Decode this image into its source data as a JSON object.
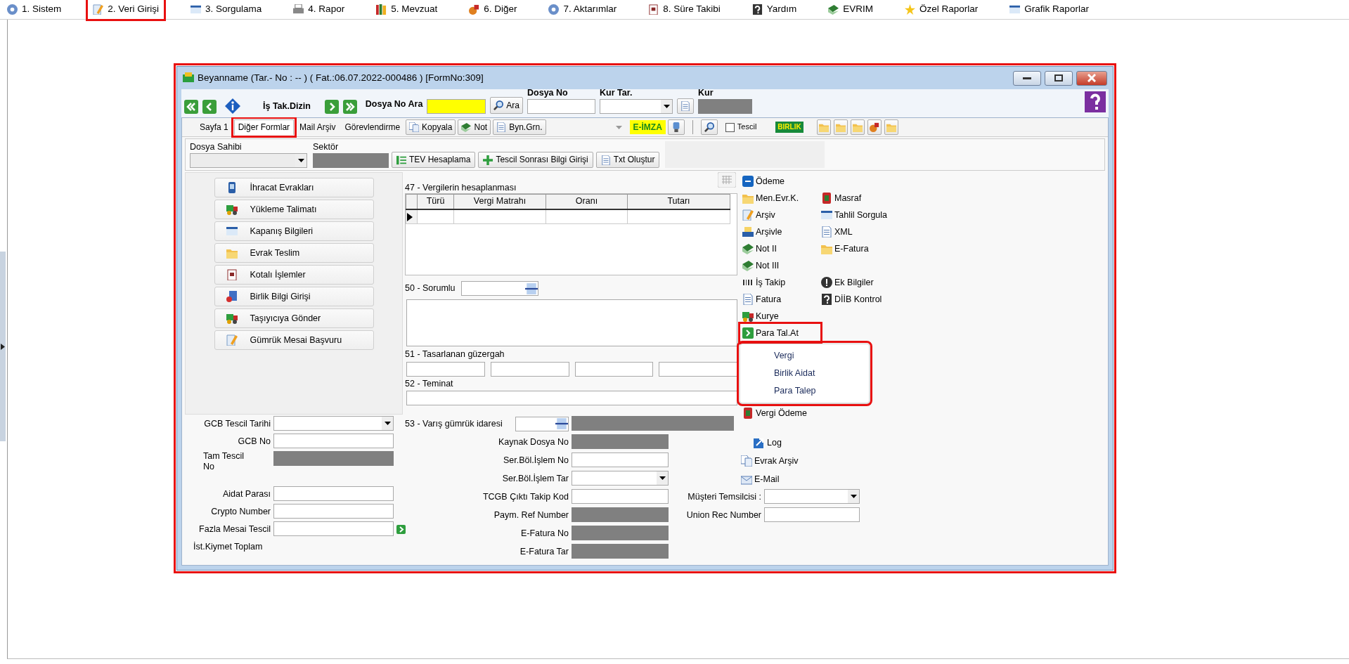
{
  "menu_bar": [
    {
      "label": "1. Sistem",
      "highlighted": false
    },
    {
      "label": "2. Veri Girişi",
      "highlighted": true
    },
    {
      "label": "3. Sorgulama",
      "highlighted": false
    },
    {
      "label": "4. Rapor",
      "highlighted": false
    },
    {
      "label": "5. Mevzuat",
      "highlighted": false
    },
    {
      "label": "6. Diğer",
      "highlighted": false
    },
    {
      "label": "7. Aktarımlar",
      "highlighted": false
    },
    {
      "label": "8. Süre Takibi",
      "highlighted": false
    },
    {
      "label": "Yardım",
      "highlighted": false
    },
    {
      "label": "EVRIM",
      "highlighted": false
    },
    {
      "label": "Özel Raporlar",
      "highlighted": false
    },
    {
      "label": "Grafik Raporlar",
      "highlighted": false
    }
  ],
  "window": {
    "title": "Beyanname (Tar.- No : -- ) ( Fat.:06.07.2022-000486 ) [FormNo:309]",
    "highlighted": true
  },
  "toolbar": {
    "dizin_label": "İş Tak.Dizin",
    "search_label": "Dosya No Ara",
    "search_button": "Ara",
    "dosya_no_label": "Dosya No",
    "kur_tar_label": "Kur Tar.",
    "kur_label": "Kur"
  },
  "tabs": [
    {
      "label": "Sayfa 1",
      "selected": false,
      "highlighted": false
    },
    {
      "label": "Diğer Formlar",
      "selected": true,
      "highlighted": true
    },
    {
      "label": "Mail Arşiv",
      "selected": false,
      "highlighted": false
    },
    {
      "label": "Görevlendirme",
      "selected": false,
      "highlighted": false
    }
  ],
  "tab_buttons": [
    "Kopyala",
    "Not",
    "Byn.Grn."
  ],
  "e_imza": "E-İMZA",
  "tescil_checkbox": {
    "label": "Tescil",
    "checked": false
  },
  "birlik_badge": "BIRLIK",
  "header": {
    "dosya_sahibi_label": "Dosya Sahibi",
    "sektor_label": "Sektör",
    "buttons": [
      "TEV Hesaplama",
      "Tescil Sonrası Bilgi Girişi",
      "Txt Oluştur"
    ]
  },
  "form_buttons": [
    "İhracat Evrakları",
    "Yükleme Talimatı",
    "Kapanış Bilgileri",
    "Evrak Teslim",
    "Kotalı İşlemler",
    "Birlik Bilgi Girişi",
    "Taşıyıcıya Gönder",
    "Gümrük Mesai Başvuru"
  ],
  "left_fields": [
    {
      "label": "GCB Tescil Tarihi",
      "kind": "select"
    },
    {
      "label": "GCB No",
      "kind": "input"
    },
    {
      "label": "Tam Tescil No",
      "kind": "readonly"
    },
    {
      "label": "Aidat Parası",
      "kind": "input"
    },
    {
      "label": "Crypto Number",
      "kind": "input"
    },
    {
      "label": "Fazla Mesai Tescil",
      "kind": "action"
    },
    {
      "label": "İst.Kiymet Toplam",
      "kind": "label"
    }
  ],
  "tax_table": {
    "title": "47 - Vergilerin hesaplanması",
    "columns": [
      "Türü",
      "Vergi Matrahı",
      "Oranı",
      "Tutarı"
    ]
  },
  "sorumlu_label": "50 - Sorumlu",
  "guzergah_label": "51 - Tasarlanan güzergah",
  "teminat_label": "52 - Teminat",
  "varis_label": "53 - Varış gümrük idaresi",
  "lower_fields": [
    {
      "label": "Kaynak Dosya No",
      "kind": "readonly"
    },
    {
      "label": "Ser.Böl.İşlem No",
      "kind": "input"
    },
    {
      "label": "Ser.Böl.İşlem Tar",
      "kind": "select"
    },
    {
      "label": "TCGB Çıktı Takip Kod",
      "kind": "input"
    },
    {
      "label": "Paym. Ref Number",
      "kind": "readonly"
    },
    {
      "label": "E-Fatura No",
      "kind": "readonly"
    },
    {
      "label": "E-Fatura Tar",
      "kind": "readonly"
    }
  ],
  "side_fields": [
    {
      "label": "Müşteri Temsilcisi :",
      "kind": "select"
    },
    {
      "label": "Union Rec Number",
      "kind": "input"
    }
  ],
  "action_rows": [
    [
      {
        "label": "Ödeme",
        "highlighted": false
      }
    ],
    [
      {
        "label": "Men.Evr.K.",
        "highlighted": false
      },
      {
        "label": "Masraf",
        "highlighted": false
      }
    ],
    [
      {
        "label": "Arşiv",
        "highlighted": false
      },
      {
        "label": "Tahlil Sorgula",
        "highlighted": false
      }
    ],
    [
      {
        "label": "Arşivle",
        "highlighted": false
      },
      {
        "label": "XML",
        "highlighted": false
      }
    ],
    [
      {
        "label": "Not II",
        "highlighted": false
      },
      {
        "label": "E-Fatura",
        "highlighted": false
      }
    ],
    [
      {
        "label": "Not III",
        "highlighted": false
      }
    ],
    [
      {
        "label": "İş Takip",
        "highlighted": false
      },
      {
        "label": "Ek Bilgiler",
        "highlighted": false
      }
    ],
    [
      {
        "label": "Fatura",
        "highlighted": false
      },
      {
        "label": "DİİB Kontrol",
        "highlighted": false
      }
    ],
    [
      {
        "label": "Kurye",
        "highlighted": false
      }
    ],
    [
      {
        "label": "Para Tal.At",
        "highlighted": true
      }
    ]
  ],
  "popup_menu": {
    "highlighted": true,
    "items": [
      "Vergi",
      "Birlik Aidat",
      "Para Talep"
    ]
  },
  "payment_link": "Vergi Ödeme",
  "bottom_links": [
    "Log",
    "Evrak Arşiv",
    "E-Mail"
  ]
}
